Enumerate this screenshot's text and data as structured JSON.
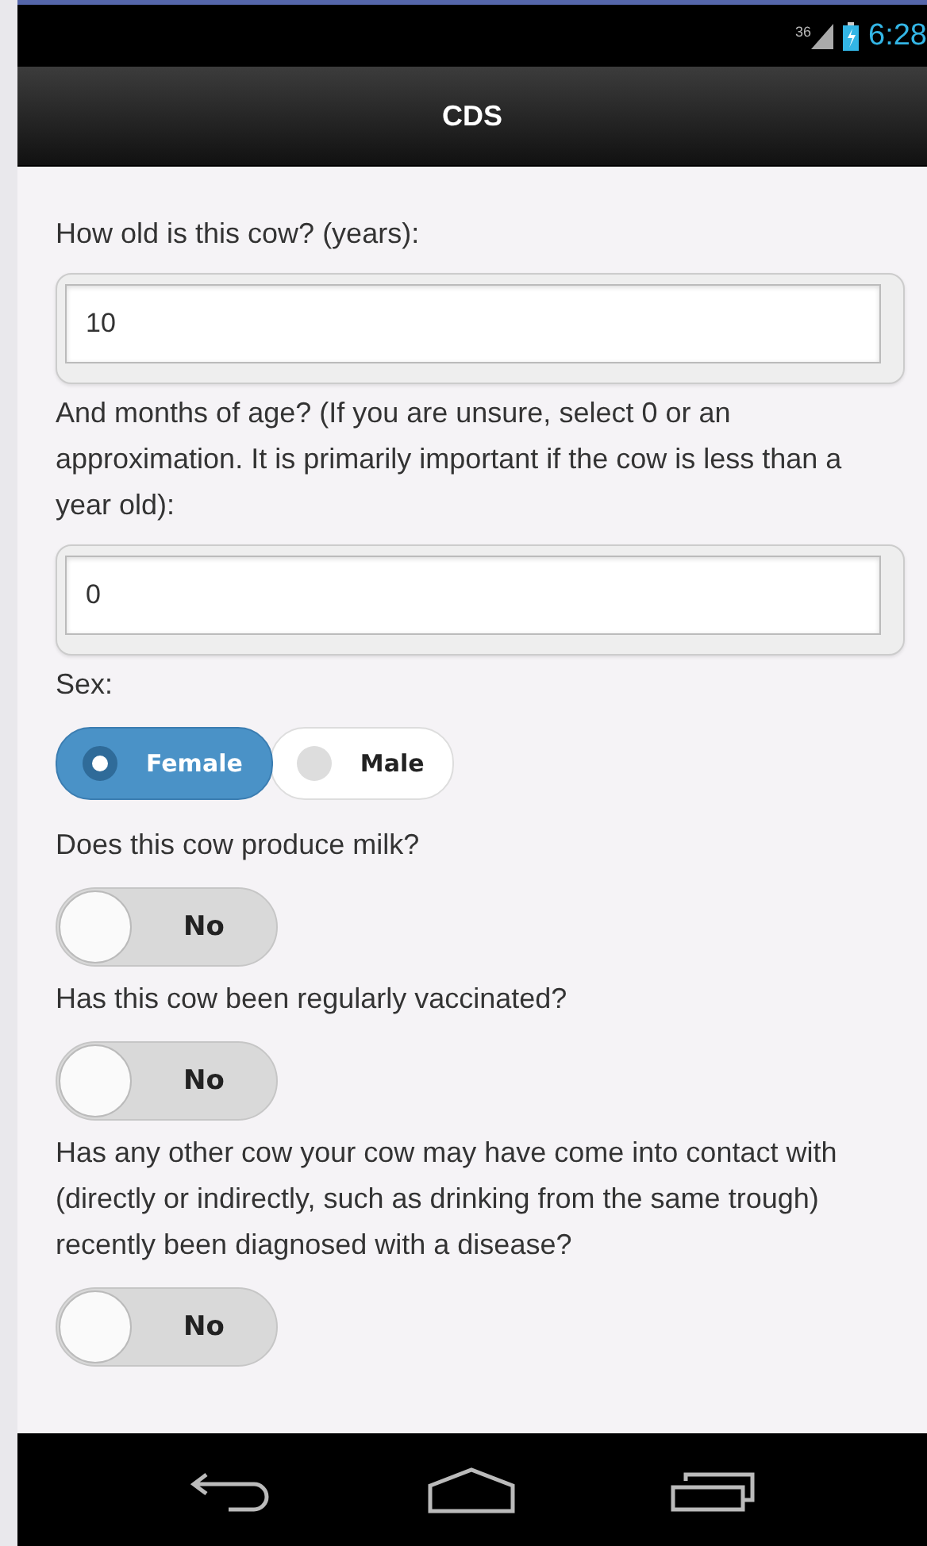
{
  "status_bar": {
    "network": "36",
    "time": "6:28"
  },
  "header": {
    "title": "CDS"
  },
  "fields": [
    {
      "kind": "number",
      "label": "How old is this cow? (years):",
      "value": "10"
    },
    {
      "kind": "number",
      "label": "And months of age? (If you are unsure, select 0 or an approximation. It is primarily important if the cow is less than a year old):",
      "value": "0"
    },
    {
      "kind": "radio",
      "label": "Sex:",
      "options": [
        {
          "label": "Female",
          "selected": true
        },
        {
          "label": "Male",
          "selected": false
        }
      ]
    },
    {
      "kind": "toggle",
      "label": "Does this cow produce milk?",
      "state_label": "No",
      "on": false
    },
    {
      "kind": "toggle",
      "label": "Has this cow been regularly vaccinated?",
      "state_label": "No",
      "on": false
    },
    {
      "kind": "toggle",
      "label": "Has any other cow your cow may have come into contact with (directly or indirectly, such as drinking from the same trough) recently been diagnosed with a disease?",
      "state_label": "No",
      "on": false
    }
  ]
}
